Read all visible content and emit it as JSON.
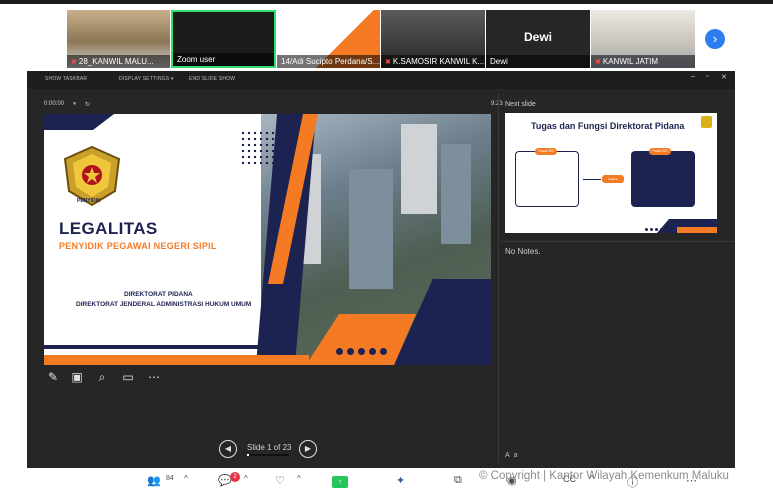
{
  "participants": {
    "tiles": [
      {
        "label": "28_KANWIL MALU...",
        "muted": true
      },
      {
        "label": "Zoom user",
        "muted": false
      },
      {
        "label": "14/Adi Sucipto Perdana/S...",
        "muted": false
      },
      {
        "label": "K.SAMOSIR KANWIL K...",
        "muted": true
      },
      {
        "label": "Dewi",
        "muted": false,
        "display_name": "Dewi"
      },
      {
        "label": "KANWIL JATIM",
        "muted": true
      }
    ],
    "next_page_icon": "chevron-right-icon"
  },
  "presenter": {
    "toolbar": {
      "show_taskbar": "SHOW TASKBAR",
      "display_settings": "DISPLAY SETTINGS ▾",
      "end_slide_show": "END SLIDE SHOW"
    },
    "timer": "0:00:00",
    "clock": "9:23",
    "next_slide_label": "Next slide",
    "notes": "No Notes.",
    "slide_counter": "Slide 1 of 23",
    "progress": 0.043,
    "current_slide": {
      "emblem_text": "PENYIDIK",
      "title": "LEGALITAS",
      "subtitle": "PENYIDIK PEGAWAI NEGERI SIPIL",
      "line1": "DIREKTORAT PIDANA",
      "line2": "DIREKTORAT JENDERAL ADMINISTRASI HUKUM UMUM"
    },
    "next_slide": {
      "title": "Tugas dan Fungsi Direktorat Pidana",
      "pill_left": "Pasal 235",
      "pill_right": "Pasal 237",
      "mid_label": "Pidana"
    }
  },
  "meeting_bar": {
    "participants_count": "84",
    "chat_badge": "2"
  },
  "watermark": "© Copyright | Kantor Wilayah Kemenkum Maluku",
  "colors": {
    "navy": "#1d2350",
    "orange": "#f47a23",
    "zoom_blue": "#2d7df0",
    "share_green": "#27c65a"
  }
}
